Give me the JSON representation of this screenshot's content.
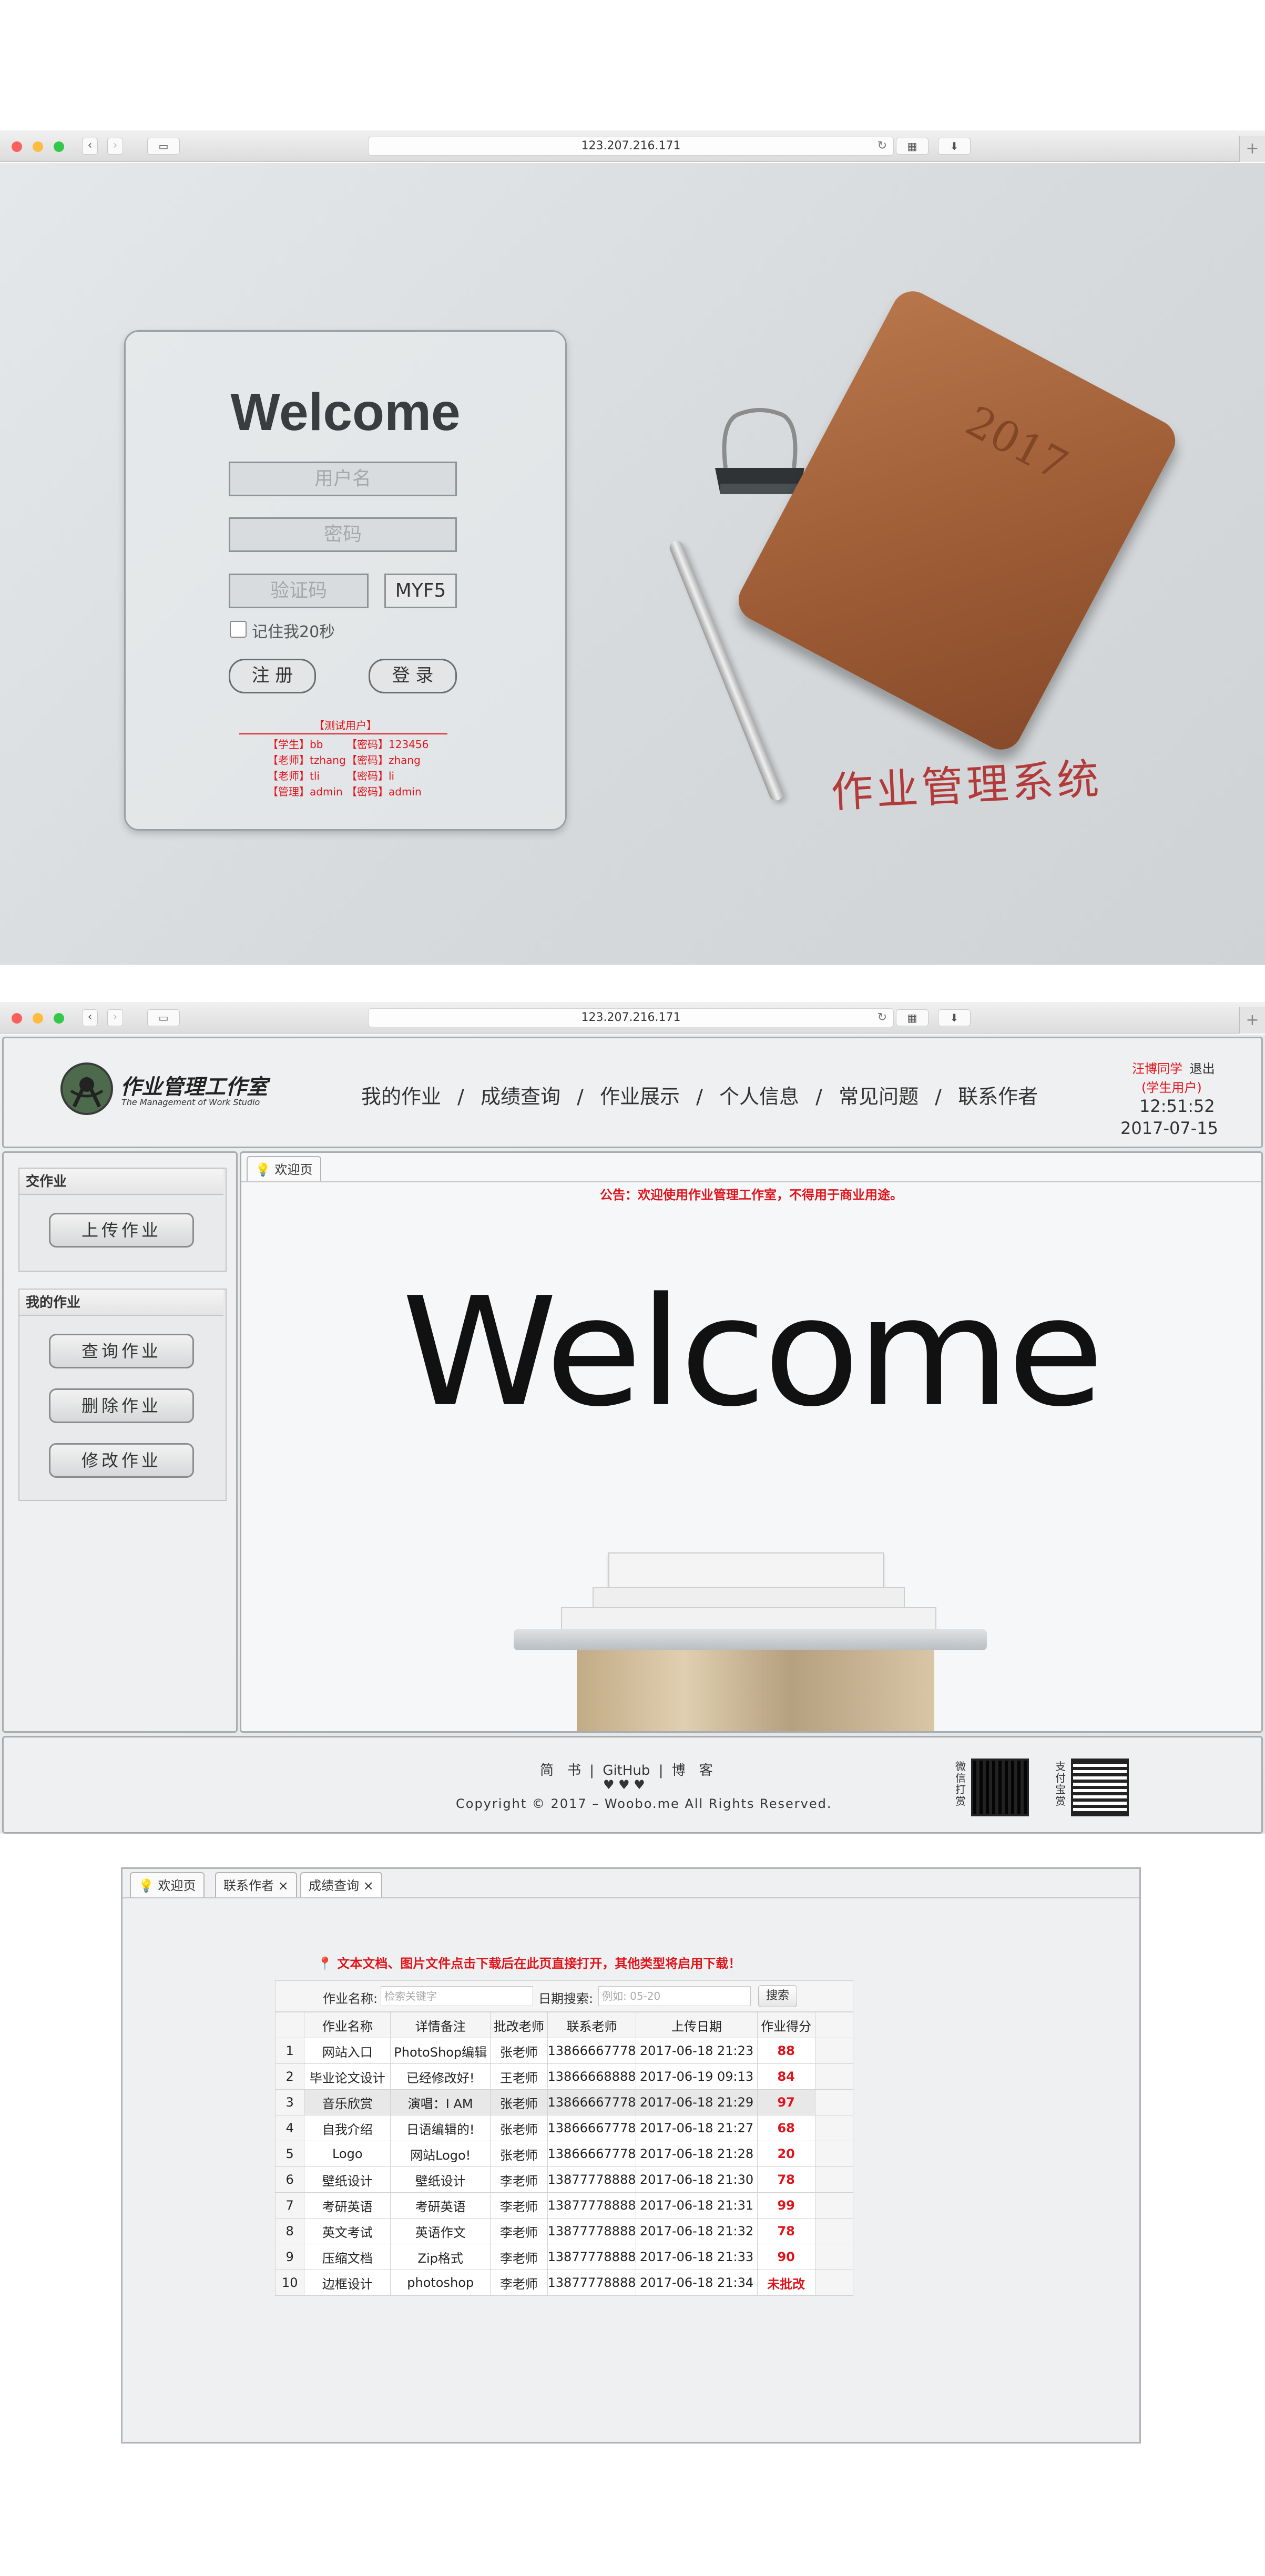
{
  "browser": {
    "url": "123.207.216.171"
  },
  "login": {
    "title": "Welcome",
    "username_placeholder": "用户名",
    "password_placeholder": "密码",
    "captcha_placeholder": "验证码",
    "captcha_code": "MYF5",
    "remember_label": "记住我20秒",
    "register_label": "注 册",
    "login_label": "登 录",
    "test_header": "【测试用户】",
    "test_users": [
      {
        "role": "【学生】bb",
        "pwd": "【密码】123456"
      },
      {
        "role": "【老师】tzhang",
        "pwd": "【密码】zhang"
      },
      {
        "role": "【老师】tli",
        "pwd": "【密码】li"
      },
      {
        "role": "【管理】admin",
        "pwd": "【密码】admin"
      }
    ],
    "system_name": "作业管理系统"
  },
  "header": {
    "logo_title": "作业管理工作室",
    "logo_subtitle": "The Management of Work Studio",
    "nav": [
      "我的作业",
      "成绩查询",
      "作业展示",
      "个人信息",
      "常见问题",
      "联系作者"
    ],
    "nav_sep": "/",
    "user_name": "汪博同学",
    "logout": "退出",
    "user_role": "(学生用户)",
    "time": "12:51:52",
    "date": "2017-07-15"
  },
  "sidebar": {
    "group1_title": "交作业",
    "upload": "上传作业",
    "group2_title": "我的作业",
    "query": "查询作业",
    "delete": "删除作业",
    "modify": "修改作业"
  },
  "main": {
    "tab_welcome": "欢迎页",
    "notice": "公告：欢迎使用作业管理工作室，不得用于商业用途。",
    "hero": "Welcome"
  },
  "footer": {
    "link1": "简　书",
    "link2": "GitHub",
    "link3": "博　客",
    "hearts": "♥ ♥ ♥",
    "copyright": "Copyright © 2017 – Woobo.me All Rights Reserved.",
    "wechat_label": "微信打赏",
    "alipay_label": "支付宝赏"
  },
  "grades": {
    "tabs": [
      "欢迎页",
      "联系作者 ×",
      "成绩查询 ×"
    ],
    "tip": "文本文档、图片文件点击下载后在此页直接打开，其他类型将启用下载！",
    "name_label": "作业名称:",
    "name_placeholder": "检索关键字",
    "date_label": "日期搜索:",
    "date_placeholder": "例如: 05-20",
    "search_label": "搜索",
    "columns": [
      "",
      "作业名称",
      "详情备注",
      "批改老师",
      "联系老师",
      "上传日期",
      "作业得分"
    ],
    "rows": [
      [
        "1",
        "网站入口",
        "PhotoShop编辑",
        "张老师",
        "13866667778",
        "2017-06-18 21:23",
        "88"
      ],
      [
        "2",
        "毕业论文设计",
        "已经修改好!",
        "王老师",
        "13866668888",
        "2017-06-19 09:13",
        "84"
      ],
      [
        "3",
        "音乐欣赏",
        "演唱：I AM",
        "张老师",
        "13866667778",
        "2017-06-18 21:29",
        "97"
      ],
      [
        "4",
        "自我介绍",
        "日语编辑的!",
        "张老师",
        "13866667778",
        "2017-06-18 21:27",
        "68"
      ],
      [
        "5",
        "Logo",
        "网站Logo!",
        "张老师",
        "13866667778",
        "2017-06-18 21:28",
        "20"
      ],
      [
        "6",
        "壁纸设计",
        "壁纸设计",
        "李老师",
        "13877778888",
        "2017-06-18 21:30",
        "78"
      ],
      [
        "7",
        "考研英语",
        "考研英语",
        "李老师",
        "13877778888",
        "2017-06-18 21:31",
        "99"
      ],
      [
        "8",
        "英文考试",
        "英语作文",
        "李老师",
        "13877778888",
        "2017-06-18 21:32",
        "78"
      ],
      [
        "9",
        "压缩文档",
        "Zip格式",
        "李老师",
        "13877778888",
        "2017-06-18 21:33",
        "90"
      ],
      [
        "10",
        "边框设计",
        "photoshop",
        "李老师",
        "13877778888",
        "2017-06-18 21:34",
        "未批改"
      ]
    ]
  }
}
